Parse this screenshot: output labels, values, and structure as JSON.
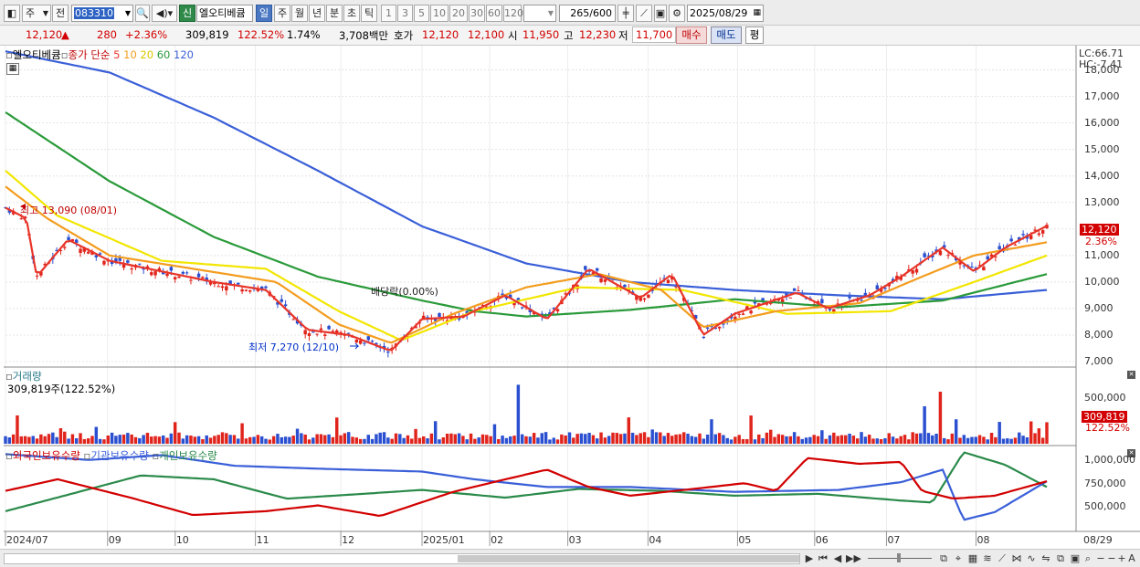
{
  "toolbar": {
    "period_select": "주",
    "prev_label": "전",
    "stock_code": "083310",
    "new_badge": "신",
    "stock_name": "엘오티베큠",
    "periods": [
      "일",
      "주",
      "월",
      "년",
      "분",
      "초",
      "틱"
    ],
    "intervals": [
      "1",
      "3",
      "5",
      "10",
      "20",
      "30",
      "60",
      "120"
    ],
    "count_value": "265",
    "count_total": "/600",
    "date": "2025/08/29"
  },
  "quote": {
    "price": "12,120",
    "change_arrow": "▲",
    "change": "280",
    "change_pct": "+2.36%",
    "volume": "309,819",
    "volume_ratio": "122.52%",
    "turnover": "1.74%",
    "amount": "3,708백만",
    "ask_label": "호가",
    "ask": "12,120",
    "bid": "12,100",
    "open_label": "시",
    "open": "11,950",
    "high_label": "고",
    "high": "12,230",
    "low_label": "저",
    "low": "11,700",
    "buy_label": "매수",
    "sell_label": "매도",
    "eval_label": "평"
  },
  "price_pane": {
    "legend_name": "엘오티베큠",
    "legend_ma_label": "종가 단순",
    "ma_periods": [
      "5",
      "10",
      "20",
      "60",
      "120"
    ],
    "ma_colors": [
      "#e8352a",
      "#f39c1e",
      "#f2e600",
      "#2a9a3a",
      "#3a5fd8"
    ],
    "lc": "LC:66.71",
    "hc": "HC:-7.41",
    "y_ticks": [
      "18,000",
      "17,000",
      "16,000",
      "15,000",
      "14,000",
      "13,000",
      "12,000",
      "11,000",
      "10,000",
      "9,000",
      "8,000",
      "7,000"
    ],
    "high_annotation": "최고 13,090 (08/01)",
    "low_annotation": "최저 7,270 (12/10)",
    "dividend_annotation": "배당락(0.00%)",
    "last_price_tag": "12,120",
    "last_pct_tag": "2.36%"
  },
  "volume_pane": {
    "title": "거래량",
    "value_text": "309,819주(122.52%)",
    "y_tick": "500,000",
    "last_tag": "309,819",
    "last_pct_tag": "122.52%"
  },
  "holding_pane": {
    "series": [
      "외국인보유수량",
      "기관보유수량",
      "개인보유수량"
    ],
    "y_ticks": [
      "1,000,000",
      "750,000",
      "500,000"
    ]
  },
  "x_axis": {
    "labels": [
      "2024/07",
      "09",
      "10",
      "11",
      "12",
      "2025/01",
      "02",
      "03",
      "04",
      "05",
      "06",
      "07",
      "08"
    ],
    "right_label": "08/29"
  },
  "chart_data": {
    "type": "candlestick",
    "price_range": [
      7000,
      18500
    ],
    "high_marker": {
      "value": 13090,
      "date": "08/01"
    },
    "low_marker": {
      "value": 7270,
      "date": "12/10"
    },
    "last_close": 12120,
    "ma_keyframes": {
      "ma120": [
        [
          0,
          18700
        ],
        [
          0.1,
          17900
        ],
        [
          0.2,
          16200
        ],
        [
          0.3,
          14200
        ],
        [
          0.4,
          12100
        ],
        [
          0.5,
          10700
        ],
        [
          0.6,
          10000
        ],
        [
          0.7,
          9700
        ],
        [
          0.8,
          9500
        ],
        [
          0.9,
          9350
        ],
        [
          1,
          9700
        ]
      ],
      "ma60": [
        [
          0,
          16400
        ],
        [
          0.1,
          13800
        ],
        [
          0.2,
          11700
        ],
        [
          0.3,
          10200
        ],
        [
          0.4,
          9300
        ],
        [
          0.45,
          8900
        ],
        [
          0.5,
          8700
        ],
        [
          0.6,
          8950
        ],
        [
          0.7,
          9350
        ],
        [
          0.8,
          9050
        ],
        [
          0.9,
          9300
        ],
        [
          1,
          10300
        ]
      ],
      "ma20": [
        [
          0,
          14200
        ],
        [
          0.05,
          12500
        ],
        [
          0.15,
          10800
        ],
        [
          0.25,
          10500
        ],
        [
          0.32,
          8900
        ],
        [
          0.38,
          7800
        ],
        [
          0.45,
          8900
        ],
        [
          0.55,
          9800
        ],
        [
          0.65,
          9700
        ],
        [
          0.75,
          8800
        ],
        [
          0.85,
          8900
        ],
        [
          0.93,
          10000
        ],
        [
          1,
          11000
        ]
      ],
      "ma10": [
        [
          0,
          13600
        ],
        [
          0.04,
          12400
        ],
        [
          0.1,
          11000
        ],
        [
          0.18,
          10500
        ],
        [
          0.26,
          10000
        ],
        [
          0.32,
          8400
        ],
        [
          0.37,
          7700
        ],
        [
          0.43,
          8800
        ],
        [
          0.5,
          9800
        ],
        [
          0.57,
          10300
        ],
        [
          0.63,
          9700
        ],
        [
          0.67,
          8300
        ],
        [
          0.74,
          8900
        ],
        [
          0.82,
          9200
        ],
        [
          0.88,
          10200
        ],
        [
          0.93,
          11000
        ],
        [
          1,
          11500
        ]
      ],
      "ma5": [
        [
          0,
          12800
        ],
        [
          0.02,
          12400
        ],
        [
          0.03,
          10200
        ],
        [
          0.06,
          11600
        ],
        [
          0.1,
          10800
        ],
        [
          0.15,
          10400
        ],
        [
          0.2,
          10000
        ],
        [
          0.25,
          9700
        ],
        [
          0.29,
          8200
        ],
        [
          0.33,
          8000
        ],
        [
          0.37,
          7400
        ],
        [
          0.4,
          8600
        ],
        [
          0.44,
          8700
        ],
        [
          0.48,
          9500
        ],
        [
          0.52,
          8600
        ],
        [
          0.56,
          10500
        ],
        [
          0.61,
          9400
        ],
        [
          0.64,
          10300
        ],
        [
          0.67,
          8000
        ],
        [
          0.7,
          8800
        ],
        [
          0.76,
          9600
        ],
        [
          0.79,
          9000
        ],
        [
          0.83,
          9500
        ],
        [
          0.86,
          10200
        ],
        [
          0.9,
          11300
        ],
        [
          0.93,
          10400
        ],
        [
          0.96,
          11300
        ],
        [
          1,
          12120
        ]
      ]
    },
    "volume_max": 1000000,
    "holding_range": [
      200000,
      1050000
    ],
    "holding_keyframes": {
      "foreign": [
        [
          0,
          600000
        ],
        [
          0.05,
          720000
        ],
        [
          0.12,
          530000
        ],
        [
          0.18,
          350000
        ],
        [
          0.25,
          390000
        ],
        [
          0.3,
          450000
        ],
        [
          0.36,
          340000
        ],
        [
          0.43,
          590000
        ],
        [
          0.48,
          720000
        ],
        [
          0.52,
          820000
        ],
        [
          0.56,
          640000
        ],
        [
          0.6,
          550000
        ],
        [
          0.66,
          620000
        ],
        [
          0.71,
          680000
        ],
        [
          0.74,
          600000
        ],
        [
          0.77,
          940000
        ],
        [
          0.82,
          880000
        ],
        [
          0.86,
          900000
        ],
        [
          0.88,
          600000
        ],
        [
          0.91,
          520000
        ],
        [
          0.95,
          550000
        ],
        [
          1,
          700000
        ]
      ],
      "institution": [
        [
          0,
          980000
        ],
        [
          0.08,
          920000
        ],
        [
          0.15,
          970000
        ],
        [
          0.22,
          860000
        ],
        [
          0.3,
          830000
        ],
        [
          0.4,
          800000
        ],
        [
          0.45,
          720000
        ],
        [
          0.52,
          640000
        ],
        [
          0.6,
          640000
        ],
        [
          0.7,
          590000
        ],
        [
          0.8,
          610000
        ],
        [
          0.86,
          690000
        ],
        [
          0.9,
          820000
        ],
        [
          0.92,
          300000
        ],
        [
          0.95,
          380000
        ],
        [
          1,
          700000
        ]
      ],
      "individual": [
        [
          0,
          390000
        ],
        [
          0.06,
          560000
        ],
        [
          0.13,
          760000
        ],
        [
          0.2,
          720000
        ],
        [
          0.27,
          520000
        ],
        [
          0.33,
          560000
        ],
        [
          0.4,
          610000
        ],
        [
          0.48,
          530000
        ],
        [
          0.55,
          620000
        ],
        [
          0.63,
          600000
        ],
        [
          0.7,
          550000
        ],
        [
          0.78,
          570000
        ],
        [
          0.86,
          500000
        ],
        [
          0.89,
          480000
        ],
        [
          0.92,
          1000000
        ],
        [
          0.96,
          870000
        ],
        [
          1,
          640000
        ]
      ]
    }
  }
}
